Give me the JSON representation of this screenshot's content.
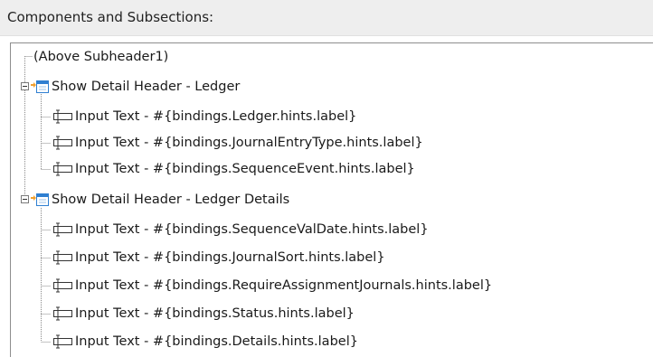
{
  "panel": {
    "title": "Components and Subsections:"
  },
  "tree": {
    "root_placeholder": "(Above Subheader1)",
    "sections": [
      {
        "label": "Show Detail Header - Ledger",
        "expanded": true,
        "children": [
          "Input Text - #{bindings.Ledger.hints.label}",
          "Input Text - #{bindings.JournalEntryType.hints.label}",
          "Input Text - #{bindings.SequenceEvent.hints.label}"
        ]
      },
      {
        "label": "Show Detail Header - Ledger Details",
        "expanded": true,
        "children": [
          "Input Text - #{bindings.SequenceValDate.hints.label}",
          "Input Text - #{bindings.JournalSort.hints.label}",
          "Input Text - #{bindings.RequireAssignmentJournals.hints.label}",
          "Input Text - #{bindings.Status.hints.label}",
          "Input Text - #{bindings.Details.hints.label}"
        ]
      }
    ]
  },
  "icons": {
    "input_text": "input-text-icon",
    "header": "show-detail-header-icon",
    "expand_toggle": "collapse-toggle-icon"
  },
  "colors": {
    "header_bg": "#eeeeee",
    "tree_line": "#808080",
    "header_icon_blue": "#2f7fd1"
  }
}
